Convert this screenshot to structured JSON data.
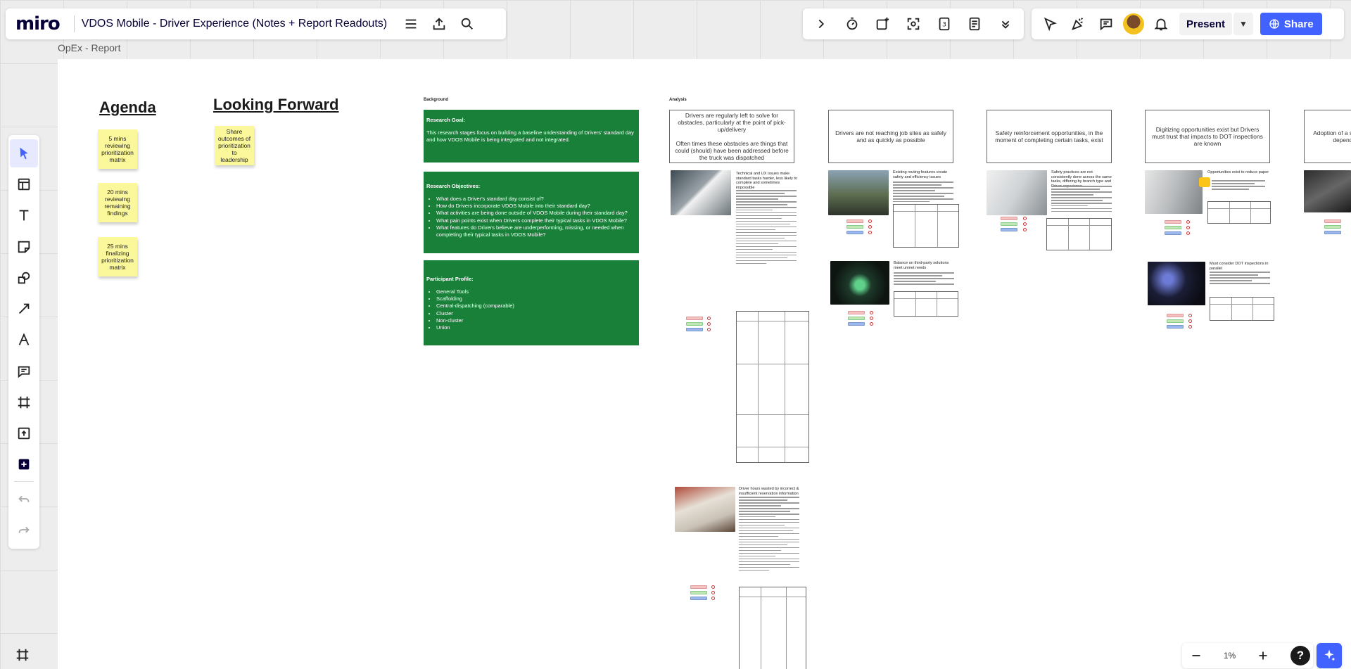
{
  "app": {
    "logo": "miro",
    "board_title": "VDOS Mobile - Driver Experience (Notes + Report Readouts)"
  },
  "toolbar_right": {
    "present_label": "Present",
    "share_label": "Share",
    "counter_value": "3"
  },
  "bottom": {
    "zoom": "1%",
    "help": "?"
  },
  "frame": {
    "label": "OpEx - Report"
  },
  "agenda": {
    "heading": "Agenda",
    "stickies": [
      "5 mins reviewing prioritization matrix",
      "20 mins reviewing remaining findings",
      "25 mins finalizing prioritization matrix"
    ]
  },
  "looking_forward": {
    "heading": "Looking Forward",
    "sticky": "Share outcomes of prioritization to leadership"
  },
  "background": {
    "label": "Background",
    "goal_title": "Research Goal:",
    "goal_text": "This research stages focus on building a baseline understanding of Drivers' standard day and how VDOS Mobile is being integrated and not integrated.",
    "objectives_title": "Research Objectives:",
    "objectives": [
      "What does a Driver's standard day consist of?",
      "How do Drivers incorporate VDOS Mobile into their standard day?",
      "What activities are being done outside of VDOS Mobile during their standard day?",
      "What pain points exist when Drivers complete their typical tasks in VDOS Mobile?",
      "What features do Drivers believe are underperforming, missing, or needed when completing their typical tasks in VDOS Mobile?"
    ],
    "profile_title": "Participant Profile:",
    "profile": [
      "General Tools",
      "Scaffolding",
      "Central-dispatching (comparable)",
      "Cluster",
      "Non-cluster",
      "Union"
    ]
  },
  "analysis": {
    "label": "Analysis",
    "findings": [
      "Drivers are regularly left to solve for obstacles, particularly at the point of pick-up/delivery\n\nOften times these obstacles are things that could (should) have been addressed before the truck was dispatched",
      "Drivers are not reaching job sites as safely and as quickly as possible",
      "Safety reinforcement opportunities, in the moment of completing certain tasks, exist",
      "Digitizing opportunities exist but Drivers must trust that impacts to DOT inspections are known",
      "Adoption of a sug heavily dependen"
    ],
    "cards": [
      "Technical and UX issues make standard tasks harder, less likely to complete and sometimes impossible",
      "Existing routing features create safety and efficiency issues",
      "Safety practices are not consistently done across the same tasks, differing by branch type and Driver experience",
      "Opportunities exist to reduce paper",
      "Balance on third-party solutions meet unmet needs",
      "Must consider DOT inspections in parallel",
      "Driver hours wasted by incorrect & insufficient reservation information"
    ]
  }
}
